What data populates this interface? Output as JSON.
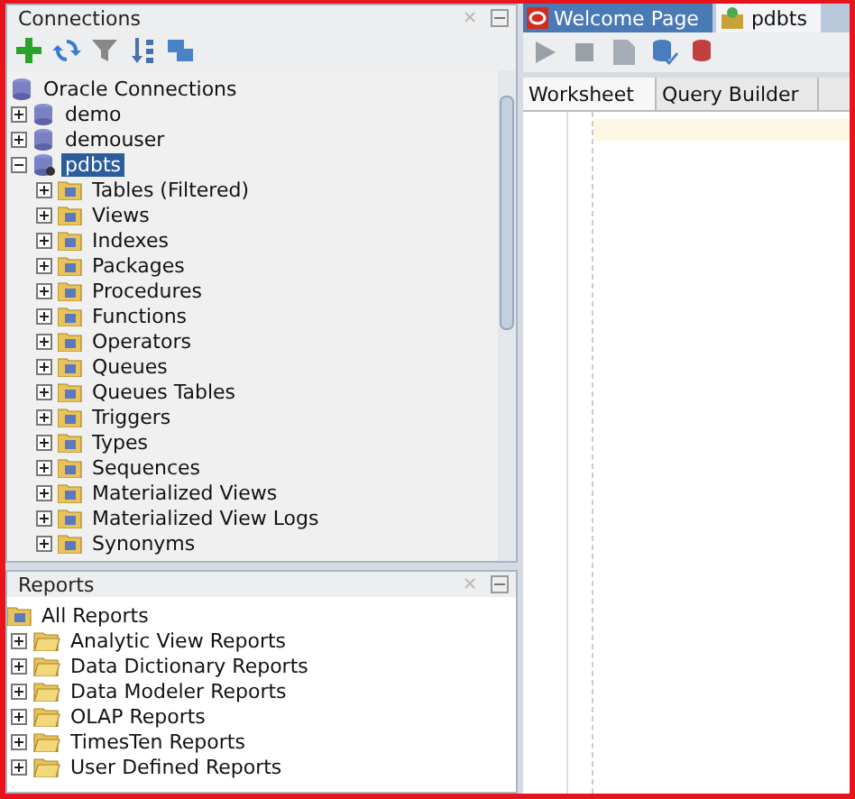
{
  "connections": {
    "title": "Connections",
    "root": {
      "label": "Oracle Connections",
      "children": [
        {
          "label": "demo",
          "kind": "connection",
          "expanded": false,
          "selected": false
        },
        {
          "label": "demouser",
          "kind": "connection",
          "expanded": false,
          "selected": false
        },
        {
          "label": "pdbts",
          "kind": "connection-open",
          "expanded": true,
          "selected": true,
          "children": [
            {
              "label": "Tables (Filtered)",
              "kind": "folder",
              "expanded": false,
              "selected": false
            },
            {
              "label": "Views",
              "kind": "folder",
              "expanded": false,
              "selected": false
            },
            {
              "label": "Indexes",
              "kind": "folder",
              "expanded": false,
              "selected": false
            },
            {
              "label": "Packages",
              "kind": "folder",
              "expanded": false,
              "selected": false
            },
            {
              "label": "Procedures",
              "kind": "folder",
              "expanded": false,
              "selected": false
            },
            {
              "label": "Functions",
              "kind": "folder",
              "expanded": false,
              "selected": false
            },
            {
              "label": "Operators",
              "kind": "folder",
              "expanded": false,
              "selected": false
            },
            {
              "label": "Queues",
              "kind": "folder",
              "expanded": false,
              "selected": false
            },
            {
              "label": "Queues Tables",
              "kind": "folder",
              "expanded": false,
              "selected": false
            },
            {
              "label": "Triggers",
              "kind": "folder",
              "expanded": false,
              "selected": false
            },
            {
              "label": "Types",
              "kind": "folder",
              "expanded": false,
              "selected": false
            },
            {
              "label": "Sequences",
              "kind": "folder",
              "expanded": false,
              "selected": false
            },
            {
              "label": "Materialized Views",
              "kind": "folder",
              "expanded": false,
              "selected": false
            },
            {
              "label": "Materialized View Logs",
              "kind": "folder",
              "expanded": false,
              "selected": false
            },
            {
              "label": "Synonyms",
              "kind": "folder",
              "expanded": false,
              "selected": false
            }
          ]
        }
      ]
    }
  },
  "reports": {
    "title": "Reports",
    "root": {
      "label": "All Reports",
      "children": [
        {
          "label": "Analytic View Reports",
          "kind": "report-folder",
          "expanded": false,
          "selected": false
        },
        {
          "label": "Data Dictionary Reports",
          "kind": "report-folder",
          "expanded": false,
          "selected": false
        },
        {
          "label": "Data Modeler Reports",
          "kind": "report-folder",
          "expanded": false,
          "selected": false
        },
        {
          "label": "OLAP Reports",
          "kind": "report-folder",
          "expanded": false,
          "selected": false
        },
        {
          "label": "TimesTen Reports",
          "kind": "report-folder",
          "expanded": false,
          "selected": false
        },
        {
          "label": "User Defined Reports",
          "kind": "report-folder",
          "expanded": false,
          "selected": false
        }
      ]
    }
  },
  "editor": {
    "tabs": [
      {
        "label": "Welcome Page",
        "kind": "welcome",
        "selected": false
      },
      {
        "label": "pdbts",
        "kind": "sql",
        "selected": true
      }
    ],
    "subtabs": [
      {
        "label": "Worksheet",
        "selected": true
      },
      {
        "label": "Query Builder",
        "selected": false
      }
    ]
  }
}
